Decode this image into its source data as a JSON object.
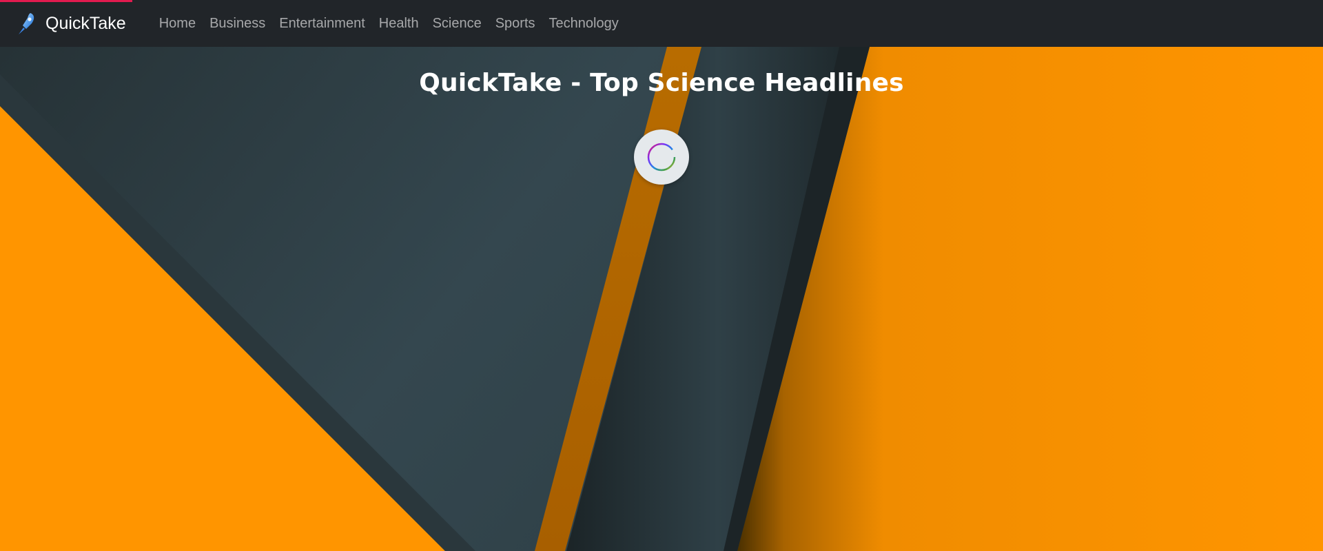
{
  "app": {
    "name": "QuickTake"
  },
  "progress": {
    "fraction": 0.1
  },
  "nav": {
    "items": [
      {
        "label": "Home"
      },
      {
        "label": "Business"
      },
      {
        "label": "Entertainment"
      },
      {
        "label": "Health"
      },
      {
        "label": "Science"
      },
      {
        "label": "Sports"
      },
      {
        "label": "Technology"
      }
    ]
  },
  "hero": {
    "title": "QuickTake - Top Science Headlines"
  },
  "icons": {
    "brand": "rocket-icon",
    "loader": "spinner-icon"
  },
  "colors": {
    "navbar": "#212529",
    "accent": "#e21b4f",
    "orange": "#ff9500",
    "slate": "#34474f"
  }
}
